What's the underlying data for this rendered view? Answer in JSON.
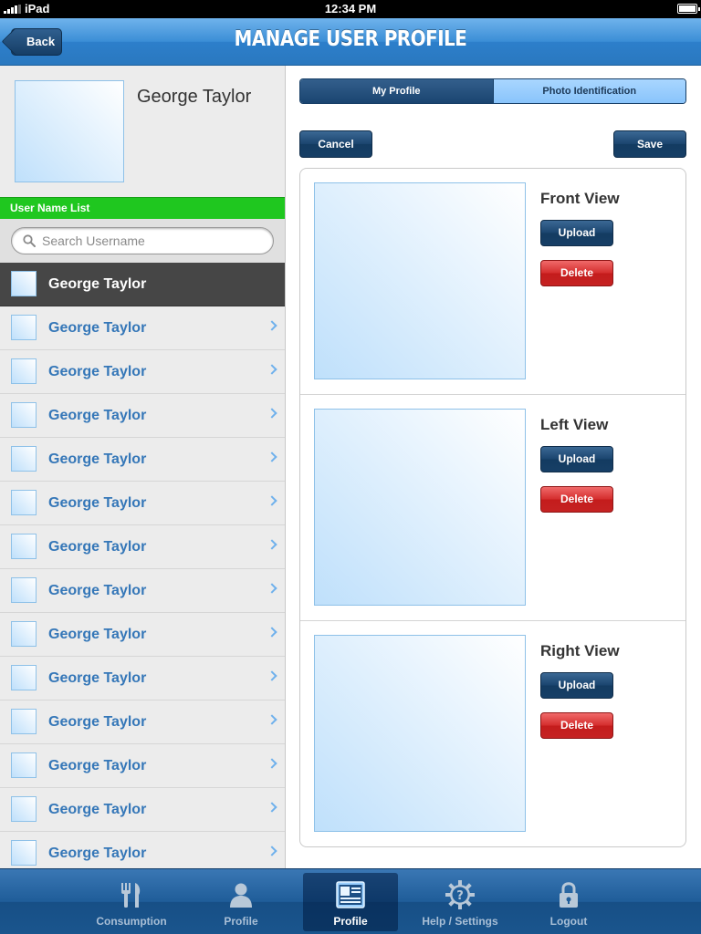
{
  "status_bar": {
    "carrier": "iPad",
    "time": "12:34 PM"
  },
  "nav": {
    "title": "MANAGE USER PROFILE",
    "back_label": "Back"
  },
  "profile": {
    "name": "George Taylor"
  },
  "user_list": {
    "header": "User Name List",
    "search_placeholder": "Search Username",
    "items": [
      {
        "name": "George Taylor",
        "selected": true
      },
      {
        "name": "George Taylor"
      },
      {
        "name": "George Taylor"
      },
      {
        "name": "George Taylor"
      },
      {
        "name": "George Taylor"
      },
      {
        "name": "George Taylor"
      },
      {
        "name": "George Taylor"
      },
      {
        "name": "George Taylor"
      },
      {
        "name": "George Taylor"
      },
      {
        "name": "George Taylor"
      },
      {
        "name": "George Taylor"
      },
      {
        "name": "George Taylor"
      },
      {
        "name": "George Taylor"
      },
      {
        "name": "George Taylor"
      }
    ]
  },
  "segments": {
    "my_profile": "My Profile",
    "photo_id": "Photo Identification",
    "active": "my_profile"
  },
  "actions": {
    "cancel": "Cancel",
    "save": "Save"
  },
  "photos": {
    "upload_label": "Upload",
    "delete_label": "Delete",
    "views": [
      {
        "label": "Front View"
      },
      {
        "label": "Left View"
      },
      {
        "label": "Right View"
      }
    ]
  },
  "tabs": [
    {
      "label": "Consumption",
      "icon": "fork-knife-icon"
    },
    {
      "label": "Profile",
      "icon": "person-icon"
    },
    {
      "label": "Profile",
      "icon": "id-card-icon",
      "active": true
    },
    {
      "label": "Help / Settings",
      "icon": "gear-question-icon"
    },
    {
      "label": "Logout",
      "icon": "lock-icon"
    }
  ],
  "colors": {
    "nav_blue": "#3b8ed6",
    "list_header_green": "#1fc71f",
    "selected_row": "#464646",
    "name_blue": "#3577b8",
    "delete_red": "#d42d2d",
    "dark_button": "#1a446e"
  }
}
